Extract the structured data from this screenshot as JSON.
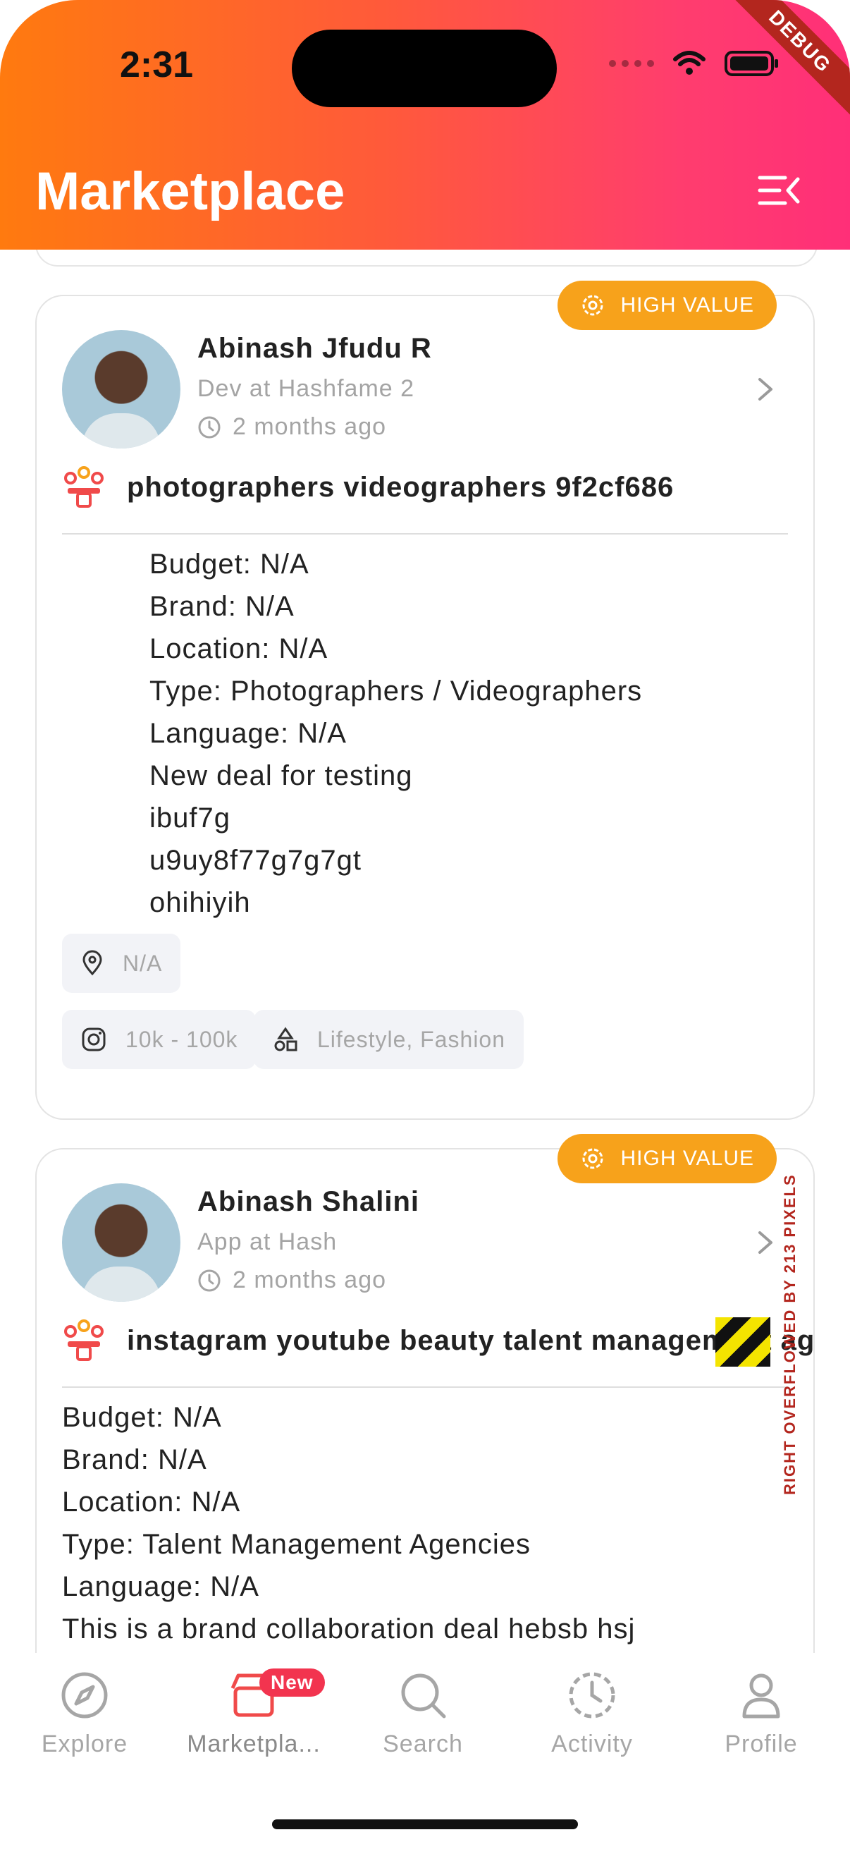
{
  "status_bar": {
    "time": "2:31",
    "debug_label": "DEBUG"
  },
  "header": {
    "title": "Marketplace",
    "menu_icon": "menu-collapse-icon"
  },
  "colors": {
    "header_start": "#ff7a0f",
    "header_end": "#ff2f78",
    "badge": "#f7a21b",
    "chip_bg": "#f2f3f7",
    "new_badge": "#f2344f"
  },
  "cards": [
    {
      "badge": "HIGH VALUE",
      "name": "Abinash Jfudu R",
      "role": "Dev at Hashfame 2",
      "time_ago": "2 months ago",
      "deal_title": "photographers videographers 9f2cf686",
      "details": [
        "Budget: N/A",
        "Brand: N/A",
        "Location: N/A",
        "Type: Photographers / Videographers",
        "Language: N/A",
        "New deal for testing",
        "ibuf7g",
        "u9uy8f77g7g7gt",
        "ohihiyih"
      ],
      "chips": {
        "location": "N/A",
        "followers": "10k - 100k",
        "categories": "Lifestyle, Fashion"
      }
    },
    {
      "badge": "HIGH VALUE",
      "name": "Abinash Shalini",
      "role": "App at Hash",
      "time_ago": "2 months ago",
      "deal_title": "instagram youtube beauty talent management ag",
      "details": [
        "Budget: N/A",
        "Brand: N/A",
        "Location: N/A",
        "Type: Talent Management Agencies",
        "Language: N/A",
        "This is a brand collaboration deal hebsb hsj"
      ]
    }
  ],
  "overflow_warning": "RIGHT OVERFLOWED BY 213 PIXELS",
  "bottom_nav": [
    {
      "label": "Explore",
      "icon": "compass-icon"
    },
    {
      "label": "Marketpla...",
      "icon": "store-icon",
      "badge": "New",
      "active": true
    },
    {
      "label": "Search",
      "icon": "search-icon"
    },
    {
      "label": "Activity",
      "icon": "clock-history-icon"
    },
    {
      "label": "Profile",
      "icon": "person-icon"
    }
  ]
}
